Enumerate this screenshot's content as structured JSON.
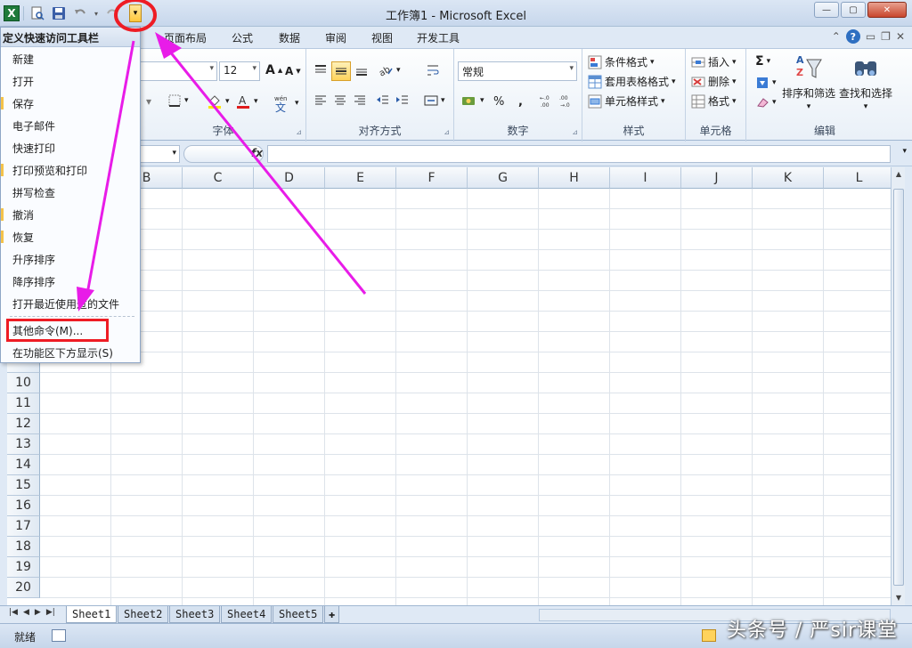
{
  "window": {
    "title": "工作簿1 - Microsoft Excel",
    "controls": [
      "—",
      "▢",
      "✕"
    ]
  },
  "qat": {
    "icons": [
      "excel-logo-icon",
      "print-preview-icon",
      "save-icon",
      "undo-icon",
      "redo-icon",
      "customize-qat-dropdown-icon"
    ],
    "logo_letter": "X"
  },
  "ribbon_tabs": [
    "页面布局",
    "公式",
    "数据",
    "审阅",
    "视图",
    "开发工具"
  ],
  "ribbon": {
    "font": {
      "size": "12",
      "label": "字体"
    },
    "alignment": {
      "label": "对齐方式"
    },
    "number": {
      "format": "常规",
      "label": "数字",
      "percent": "%",
      "comma": ","
    },
    "styles": {
      "label": "样式",
      "items": [
        "条件格式",
        "套用表格格式",
        "单元格样式"
      ]
    },
    "cells": {
      "label": "单元格",
      "items": [
        "插入",
        "删除",
        "格式"
      ]
    },
    "editing": {
      "label": "编辑",
      "sort_filter": "排序和筛选",
      "find_select": "查找和选择",
      "sigma": "Σ"
    }
  },
  "formula_bar": {
    "fx": "fx"
  },
  "grid": {
    "columns": [
      "B",
      "C",
      "D",
      "E",
      "F",
      "G",
      "H",
      "I",
      "J",
      "K",
      "L"
    ],
    "rows": [
      "10",
      "11",
      "12",
      "13",
      "14",
      "15",
      "16",
      "17",
      "18",
      "19",
      "20"
    ]
  },
  "menu": {
    "title": "定义快速访问工具栏",
    "items": [
      "新建",
      "打开",
      "保存",
      "电子邮件",
      "快速打印",
      "打印预览和打印",
      "拼写检查",
      "撤消",
      "恢复",
      "升序排序",
      "降序排序",
      "打开最近使用过的文件"
    ],
    "more_commands": "其他命令(M)...",
    "show_below": "在功能区下方显示(S)"
  },
  "sheets": [
    "Sheet1",
    "Sheet2",
    "Sheet3",
    "Sheet4",
    "Sheet5"
  ],
  "status": {
    "ready": "就绪"
  },
  "watermark": "头条号 / 严sir课堂",
  "colors": {
    "annotation": "#e81ce8",
    "highlight": "#ee1c24",
    "excel_green": "#1e7a3a"
  }
}
